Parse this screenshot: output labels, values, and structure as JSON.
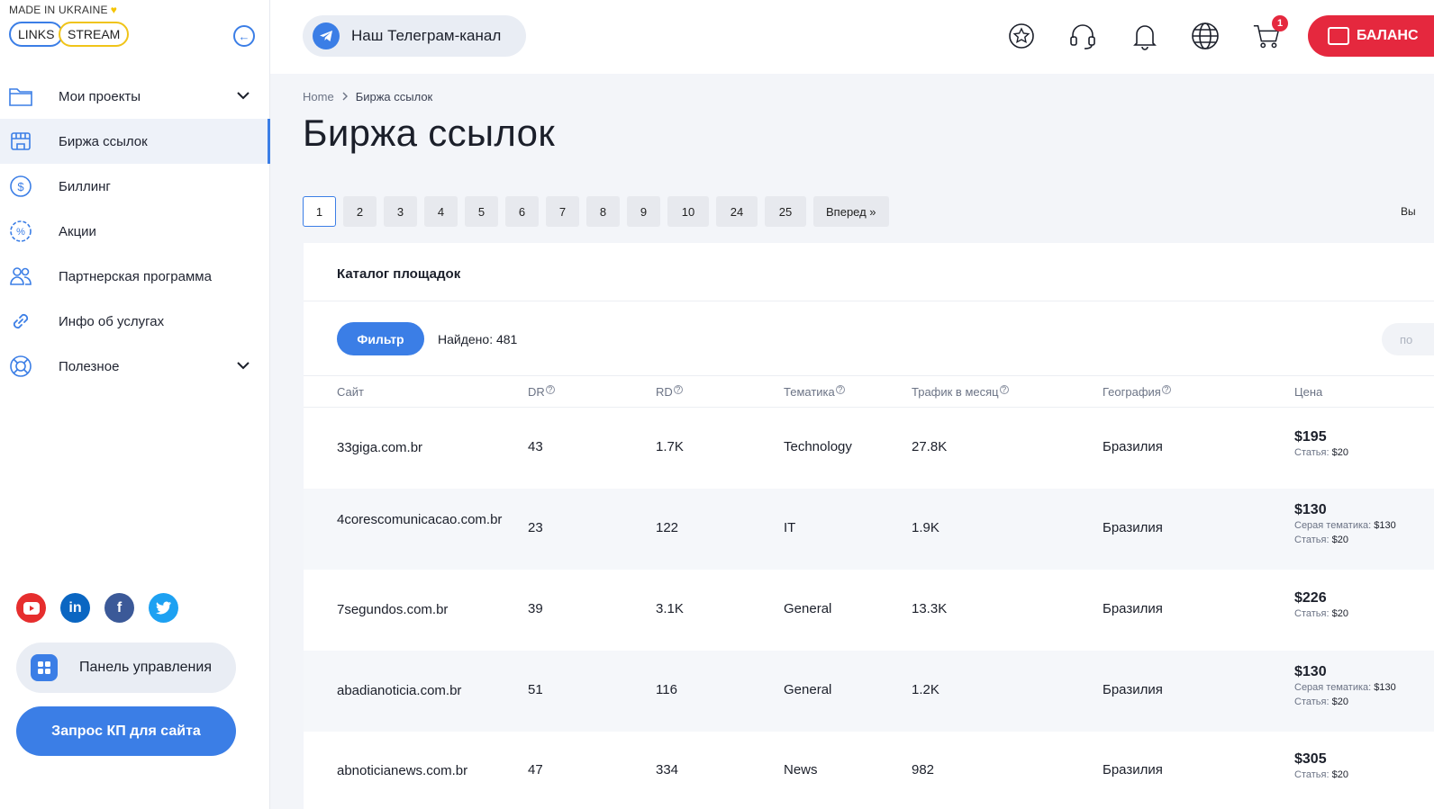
{
  "logo": {
    "made_in": "MADE IN UKRAINE",
    "word1": "LINKS",
    "word2": "STREAM"
  },
  "sidebar": {
    "items": [
      {
        "label": "Мои проекты",
        "icon": "folder-icon",
        "expandable": true
      },
      {
        "label": "Биржа ссылок",
        "icon": "storefront-icon",
        "active": true
      },
      {
        "label": "Биллинг",
        "icon": "dollar-icon"
      },
      {
        "label": "Акции",
        "icon": "percent-badge-icon"
      },
      {
        "label": "Партнерская программа",
        "icon": "users-icon"
      },
      {
        "label": "Инфо об услугах",
        "icon": "link-icon"
      },
      {
        "label": "Полезное",
        "icon": "lifebuoy-icon",
        "expandable": true
      }
    ],
    "socials": [
      "youtube-icon",
      "linkedin-icon",
      "facebook-icon",
      "twitter-icon"
    ],
    "panel_label": "Панель управления",
    "kp_label": "Запрос КП для сайта"
  },
  "header": {
    "telegram_label": "Наш Телеграм-канал",
    "cart_count": "1",
    "balance_label": "БАЛАНС"
  },
  "breadcrumb": {
    "home": "Home",
    "current": "Биржа ссылок"
  },
  "page_title": "Биржа ссылок",
  "pagination": {
    "pages": [
      "1",
      "2",
      "3",
      "4",
      "5",
      "6",
      "7",
      "8",
      "9",
      "10",
      "24",
      "25"
    ],
    "current": "1",
    "next": "Вперед »",
    "right_cut": "Вы"
  },
  "catalog": {
    "title": "Каталог площадок",
    "filter_label": "Фильтр",
    "found_label": "Найдено:",
    "found_count": "481",
    "search_placeholder": "по",
    "columns": [
      "Сайт",
      "DR",
      "RD",
      "Тематика",
      "Трафик в месяц",
      "География",
      "Цена"
    ],
    "rows": [
      {
        "site": "33giga.com.br",
        "dr": "43",
        "rd": "1.7K",
        "topic": "Technology",
        "traffic": "27.8K",
        "geo": "Бразилия",
        "price": "$195",
        "notes": [
          {
            "k": "Статья:",
            "v": "$20"
          }
        ]
      },
      {
        "site": "4corescomunicacao.com.br",
        "dr": "23",
        "rd": "122",
        "topic": "IT",
        "traffic": "1.9K",
        "geo": "Бразилия",
        "price": "$130",
        "notes": [
          {
            "k": "Серая тематика:",
            "v": "$130"
          },
          {
            "k": "Статья:",
            "v": "$20"
          }
        ]
      },
      {
        "site": "7segundos.com.br",
        "dr": "39",
        "rd": "3.1K",
        "topic": "General",
        "traffic": "13.3K",
        "geo": "Бразилия",
        "price": "$226",
        "notes": [
          {
            "k": "Статья:",
            "v": "$20"
          }
        ]
      },
      {
        "site": "abadianoticia.com.br",
        "dr": "51",
        "rd": "116",
        "topic": "General",
        "traffic": "1.2K",
        "geo": "Бразилия",
        "price": "$130",
        "notes": [
          {
            "k": "Серая тематика:",
            "v": "$130"
          },
          {
            "k": "Статья:",
            "v": "$20"
          }
        ]
      },
      {
        "site": "abnoticianews.com.br",
        "dr": "47",
        "rd": "334",
        "topic": "News",
        "traffic": "982",
        "geo": "Бразилия",
        "price": "$305",
        "notes": [
          {
            "k": "Статья:",
            "v": "$20"
          }
        ]
      }
    ]
  },
  "colors": {
    "accent": "#3b7ee6",
    "danger": "#e5283e",
    "bg": "#f3f5f9"
  }
}
